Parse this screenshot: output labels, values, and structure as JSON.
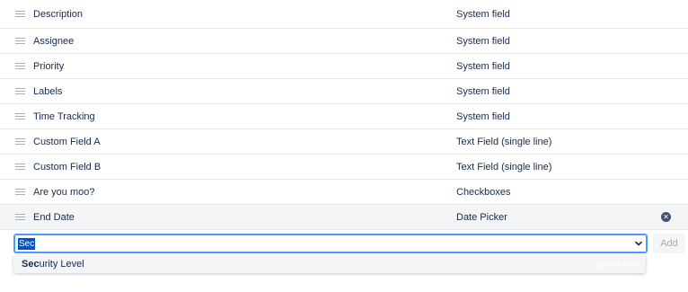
{
  "fields": [
    {
      "name": "Description",
      "type": "System field"
    },
    {
      "name": "Assignee",
      "type": "System field"
    },
    {
      "name": "Priority",
      "type": "System field"
    },
    {
      "name": "Labels",
      "type": "System field"
    },
    {
      "name": "Time Tracking",
      "type": "System field"
    },
    {
      "name": "Custom Field A",
      "type": "Text Field (single line)"
    },
    {
      "name": "Custom Field B",
      "type": "Text Field (single line)"
    },
    {
      "name": "Are you moo?",
      "type": "Checkboxes"
    },
    {
      "name": "End Date",
      "type": "Date Picker"
    }
  ],
  "add_field": {
    "input_value": "Sec",
    "add_label": "Add",
    "suggestion": {
      "match": "Sec",
      "rest": "urity Level",
      "hint": "System field"
    }
  },
  "icons": {
    "drag": "drag-handle-icon",
    "remove": "remove-circle-icon",
    "caret": "chevron-down-icon"
  },
  "colors": {
    "focus": "#4c9aff",
    "selection": "#0052cc",
    "text": "#172b4d"
  }
}
